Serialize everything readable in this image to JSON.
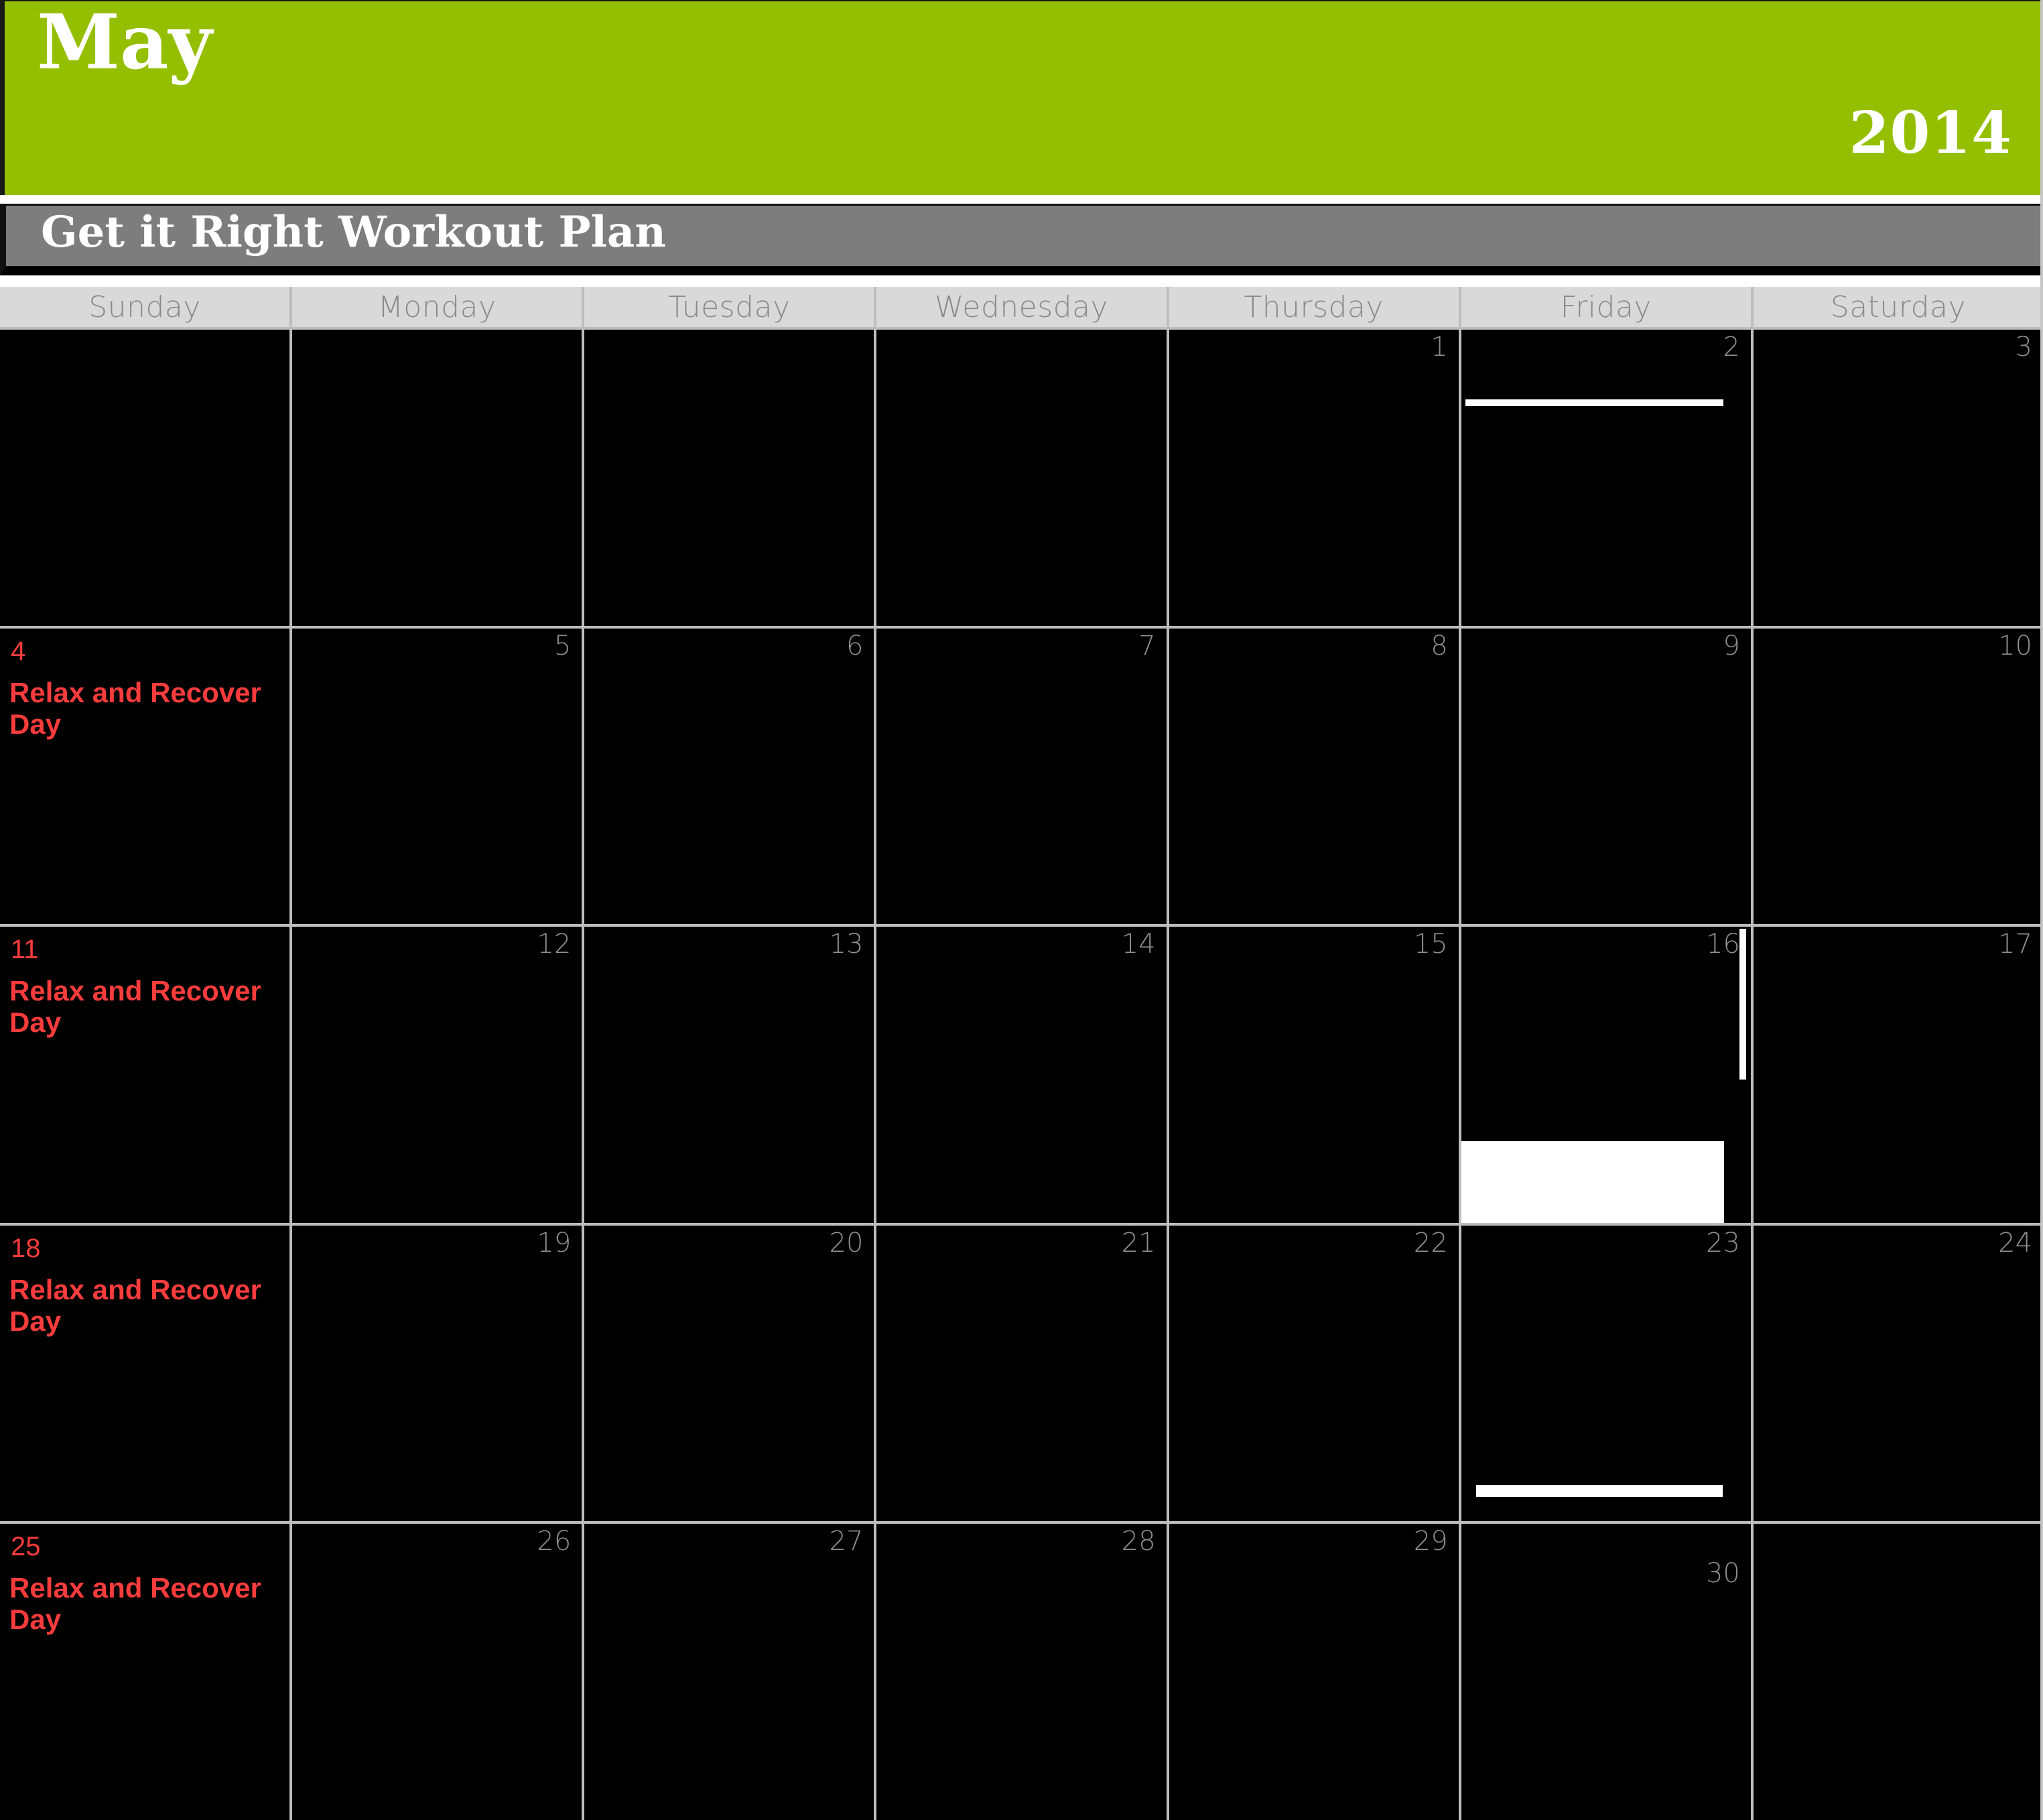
{
  "banner": {
    "month": "May",
    "year": "2014",
    "background_color": "#94BF00",
    "text_color": "#FFFFFF"
  },
  "subtitle": {
    "text": "Get it Right Workout Plan",
    "background_color": "#7D7D7D",
    "text_color": "#FFFFFF"
  },
  "colors": {
    "grid_line": "#BDBDBD",
    "cell_background": "#000000",
    "day_header_background": "#D9D9D9",
    "day_header_text": "#8A8A8A",
    "day_number_text": "#8F8F8F",
    "event_text": "#FA3C3C",
    "mark": "#FFFFFF"
  },
  "day_headers": [
    "Sunday",
    "Monday",
    "Tuesday",
    "Wednesday",
    "Thursday",
    "Friday",
    "Saturday"
  ],
  "event_label": "Relax and Recover Day",
  "weeks": [
    [
      {
        "day": "",
        "event": "",
        "rest": false,
        "mark": "none"
      },
      {
        "day": "",
        "event": "",
        "rest": false,
        "mark": "none"
      },
      {
        "day": "",
        "event": "",
        "rest": false,
        "mark": "none"
      },
      {
        "day": "",
        "event": "",
        "rest": false,
        "mark": "none"
      },
      {
        "day": "1",
        "event": "",
        "rest": false,
        "mark": "none"
      },
      {
        "day": "2",
        "event": "",
        "rest": false,
        "mark": "bar-thin"
      },
      {
        "day": "3",
        "event": "",
        "rest": false,
        "mark": "none"
      }
    ],
    [
      {
        "day": "4",
        "event": "Relax and Recover Day",
        "rest": true,
        "mark": "none"
      },
      {
        "day": "5",
        "event": "",
        "rest": false,
        "mark": "none"
      },
      {
        "day": "6",
        "event": "",
        "rest": false,
        "mark": "none"
      },
      {
        "day": "7",
        "event": "",
        "rest": false,
        "mark": "none"
      },
      {
        "day": "8",
        "event": "",
        "rest": false,
        "mark": "none"
      },
      {
        "day": "9",
        "event": "",
        "rest": false,
        "mark": "none"
      },
      {
        "day": "10",
        "event": "",
        "rest": false,
        "mark": "none"
      }
    ],
    [
      {
        "day": "11",
        "event": "Relax and Recover Day",
        "rest": true,
        "mark": "none"
      },
      {
        "day": "12",
        "event": "",
        "rest": false,
        "mark": "none"
      },
      {
        "day": "13",
        "event": "",
        "rest": false,
        "mark": "none"
      },
      {
        "day": "14",
        "event": "",
        "rest": false,
        "mark": "none"
      },
      {
        "day": "15",
        "event": "",
        "rest": false,
        "mark": "none"
      },
      {
        "day": "16",
        "event": "",
        "rest": false,
        "mark": "block-stem"
      },
      {
        "day": "17",
        "event": "",
        "rest": false,
        "mark": "none"
      }
    ],
    [
      {
        "day": "18",
        "event": "Relax and Recover Day",
        "rest": true,
        "mark": "none"
      },
      {
        "day": "19",
        "event": "",
        "rest": false,
        "mark": "none"
      },
      {
        "day": "20",
        "event": "",
        "rest": false,
        "mark": "none"
      },
      {
        "day": "21",
        "event": "",
        "rest": false,
        "mark": "none"
      },
      {
        "day": "22",
        "event": "",
        "rest": false,
        "mark": "none"
      },
      {
        "day": "23",
        "event": "",
        "rest": false,
        "mark": "bar-thick"
      },
      {
        "day": "24",
        "event": "",
        "rest": false,
        "mark": "none"
      }
    ],
    [
      {
        "day": "25",
        "event": "Relax and Recover Day",
        "rest": true,
        "mark": "none"
      },
      {
        "day": "26",
        "event": "",
        "rest": false,
        "mark": "none"
      },
      {
        "day": "27",
        "event": "",
        "rest": false,
        "mark": "none"
      },
      {
        "day": "28",
        "event": "",
        "rest": false,
        "mark": "none"
      },
      {
        "day": "29",
        "event": "",
        "rest": false,
        "mark": "none"
      },
      {
        "day": "30",
        "event": "",
        "rest": false,
        "mark": "none",
        "daynum_offset_top": 54
      },
      {
        "day": "",
        "event": "",
        "rest": false,
        "mark": "none"
      }
    ]
  ]
}
